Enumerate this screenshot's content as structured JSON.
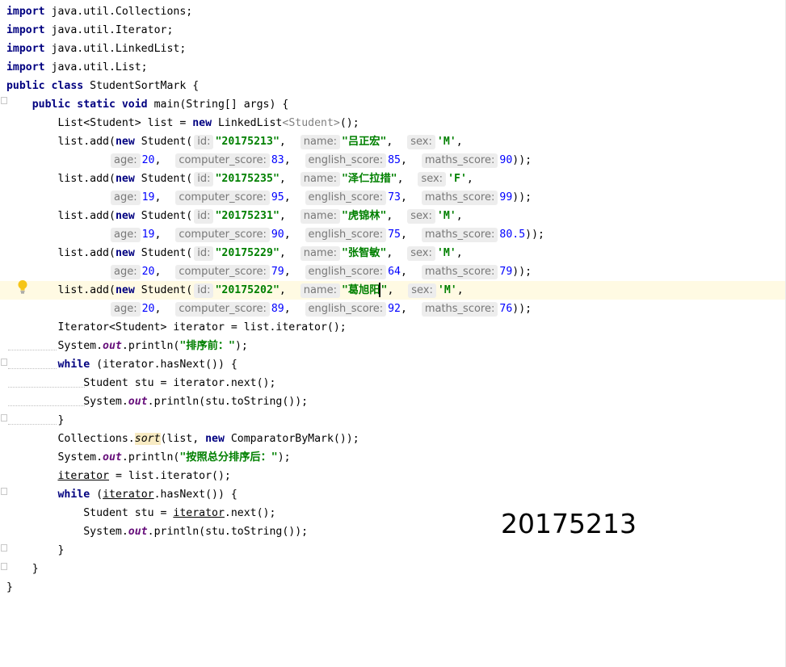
{
  "editor": {
    "imports": [
      "java.util.Collections;",
      "java.util.Iterator;",
      "java.util.LinkedList;",
      "java.util.List;"
    ],
    "kw_import": "import",
    "class_decl_kw": "public class",
    "class_name": "StudentSortMark {",
    "main_kw": "public static void",
    "main_sig": "main(String[] args) {",
    "list_decl_pre": "List<Student> list = ",
    "kw_new": "new",
    "list_decl_type": " LinkedList",
    "list_decl_generic": "<Student>",
    "list_decl_post": "();",
    "add_prefix": "list.add(",
    "student_ctor": " Student(",
    "hint_labels": {
      "id": "id:",
      "name": "name:",
      "sex": "sex:",
      "age": "age:",
      "computer_score": "computer_score:",
      "english_score": "english_score:",
      "maths_score": "maths_score:"
    },
    "students": [
      {
        "id": "\"20175213\"",
        "name": "\"吕正宏\"",
        "sex": "'M'",
        "age": "20",
        "computer": "83",
        "english": "85",
        "maths": "90"
      },
      {
        "id": "\"20175235\"",
        "name": "\"泽仁拉措\"",
        "sex": "'F'",
        "age": "19",
        "computer": "95",
        "english": "73",
        "maths": "99"
      },
      {
        "id": "\"20175231\"",
        "name": "\"虎锦林\"",
        "sex": "'M'",
        "age": "19",
        "computer": "90",
        "english": "75",
        "maths": "80.5"
      },
      {
        "id": "\"20175229\"",
        "name": "\"张智敏\"",
        "sex": "'M'",
        "age": "20",
        "computer": "79",
        "english": "64",
        "maths": "79"
      },
      {
        "id": "\"20175202\"",
        "name": "\"葛旭阳\"",
        "sex": "'M'",
        "age": "20",
        "computer": "89",
        "english": "92",
        "maths": "76"
      }
    ],
    "iterator_decl": "Iterator<Student> iterator = list.iterator();",
    "system": "System.",
    "out": "out",
    "println_open": ".println(",
    "before_sort_str": "\"排序前：\"",
    "close_paren_semicolon": ");",
    "kw_while": "while",
    "while_cond": " (iterator.hasNext()) {",
    "student_next": "Student stu = iterator.next();",
    "println_tostring": ".println(stu.toString());",
    "close_brace": "}",
    "collections_pre": "Collections.",
    "sort": "sort",
    "sort_args_pre": "(list, ",
    "sort_args_post": " ComparatorByMark());",
    "after_sort_str": "\"按照总分排序后：\"",
    "iterator_reassign_var": "iterator",
    "iterator_reassign_rest": " = list.iterator();",
    "while_cond2_pre": " (",
    "while_cond2_var": "iterator",
    "while_cond2_post": ".hasNext()) {",
    "student_next2_pre": "Student stu = ",
    "student_next2_var": "iterator",
    "student_next2_post": ".next();",
    "watermark": "20175213"
  }
}
